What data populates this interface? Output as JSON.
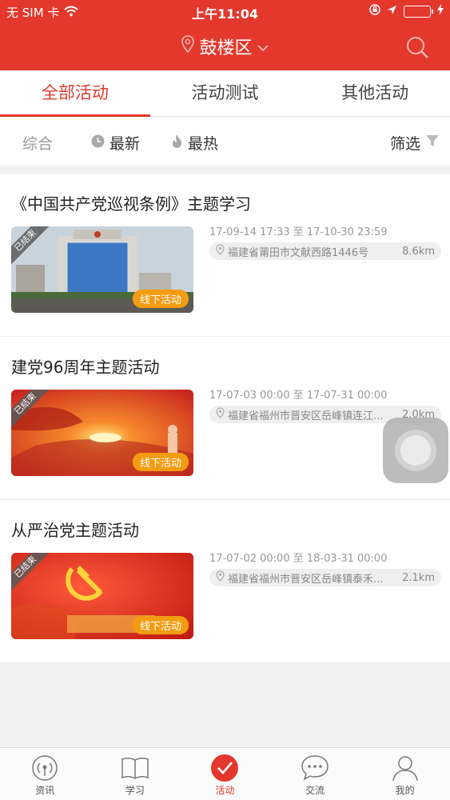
{
  "status_bar": {
    "carrier": "无 SIM 卡",
    "time": "上午11:04"
  },
  "header": {
    "location": "鼓楼区"
  },
  "tabs": [
    {
      "label": "全部活动"
    },
    {
      "label": "活动测试"
    },
    {
      "label": "其他活动"
    }
  ],
  "sort": {
    "composite": "综合",
    "latest": "最新",
    "hottest": "最热",
    "filter": "筛选"
  },
  "activities": [
    {
      "title": "《中国共产党巡视条例》主题学习",
      "status": "已结束",
      "type": "线下活动",
      "time": "17-09-14 17:33 至 17-10-30 23:59",
      "address": "福建省莆田市文献西路1446号",
      "distance": "8.6km"
    },
    {
      "title": "建党96周年主题活动",
      "status": "已结束",
      "type": "线下活动",
      "time": "17-07-03 00:00 至 17-07-31 00:00",
      "address": "福建省福州市晋安区岳峰镇连江...",
      "distance": "2.0km"
    },
    {
      "title": "从严治党主题活动",
      "status": "已结束",
      "type": "线下活动",
      "time": "17-07-02 00:00 至 18-03-31 00:00",
      "address": "福建省福州市晋安区岳峰镇泰禾...",
      "distance": "2.1km"
    }
  ],
  "bottom_nav": [
    {
      "label": "资讯",
      "icon": "radio-icon"
    },
    {
      "label": "学习",
      "icon": "book-icon"
    },
    {
      "label": "活动",
      "icon": "check-icon"
    },
    {
      "label": "交流",
      "icon": "chat-icon"
    },
    {
      "label": "我的",
      "icon": "person-icon"
    }
  ],
  "colors": {
    "brand": "#e4382d",
    "tag": "#f39c12",
    "battery": "#35c759"
  }
}
